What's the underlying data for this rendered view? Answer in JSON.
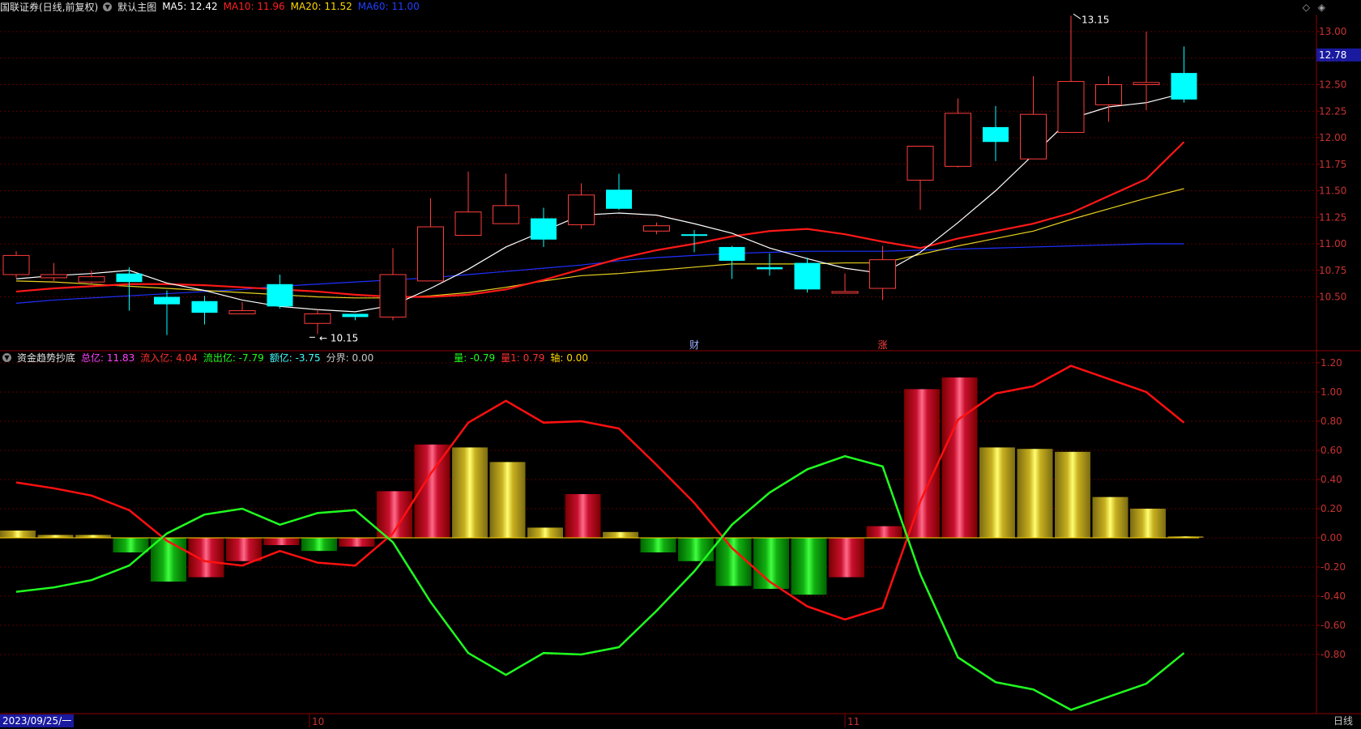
{
  "title": "国联证券(日线,前复权)",
  "main_indicator": "默认主图",
  "ma": [
    {
      "label": "MA5:",
      "value": "12.42",
      "color": "#ffffff"
    },
    {
      "label": "MA10:",
      "value": "11.96",
      "color": "#ff2020"
    },
    {
      "label": "MA20:",
      "value": "11.52",
      "color": "#ffd700"
    },
    {
      "label": "MA60:",
      "value": "11.00",
      "color": "#2040ff"
    }
  ],
  "sub_indicator": "资金趋势抄底",
  "sub_stats": [
    {
      "label": "总亿:",
      "value": "11.83",
      "color": "#ff40ff"
    },
    {
      "label": "流入亿:",
      "value": "4.04",
      "color": "#ff3030"
    },
    {
      "label": "流出亿:",
      "value": "-7.79",
      "color": "#20ff20"
    },
    {
      "label": "额亿:",
      "value": "-3.75",
      "color": "#40ffff"
    },
    {
      "label": "分界:",
      "value": "0.00",
      "color": "#c8c8c8"
    }
  ],
  "sub_stats2": [
    {
      "label": "量:",
      "value": "-0.79",
      "color": "#20ff20"
    },
    {
      "label": "量1:",
      "value": "0.79",
      "color": "#ff3030"
    },
    {
      "label": "轴:",
      "value": "0.00",
      "color": "#ffd700"
    }
  ],
  "price_axis": [
    "13.00",
    "12.75",
    "12.50",
    "12.25",
    "12.00",
    "11.75",
    "11.50",
    "11.25",
    "11.00",
    "10.75",
    "10.50"
  ],
  "current_price": "12.78",
  "high_label": "13.15",
  "low_label": "10.15",
  "event_markers": [
    "财",
    "涨"
  ],
  "osc_axis": [
    "1.20",
    "1.00",
    "0.80",
    "0.60",
    "0.40",
    "0.20",
    "0.00",
    "-0.20",
    "-0.40",
    "-0.60",
    "-0.80"
  ],
  "date_start": "2023/09/25/一",
  "month_labels": [
    "10",
    "11"
  ],
  "period_label": "日线",
  "chart_data": {
    "type": "candlestick",
    "candles": [
      {
        "o": 10.71,
        "c": 10.89,
        "h": 10.93,
        "l": 10.68
      },
      {
        "o": 10.68,
        "c": 10.71,
        "h": 10.82,
        "l": 10.65
      },
      {
        "o": 10.64,
        "c": 10.69,
        "h": 10.75,
        "l": 10.62
      },
      {
        "o": 10.72,
        "c": 10.64,
        "h": 10.78,
        "l": 10.37
      },
      {
        "o": 10.5,
        "c": 10.43,
        "h": 10.56,
        "l": 10.14
      },
      {
        "o": 10.46,
        "c": 10.35,
        "h": 10.51,
        "l": 10.24
      },
      {
        "o": 10.34,
        "c": 10.37,
        "h": 10.45,
        "l": 10.34
      },
      {
        "o": 10.62,
        "c": 10.41,
        "h": 10.71,
        "l": 10.39
      },
      {
        "o": 10.25,
        "c": 10.34,
        "h": 10.38,
        "l": 10.15
      },
      {
        "o": 10.34,
        "c": 10.31,
        "h": 10.34,
        "l": 10.28
      },
      {
        "o": 10.31,
        "c": 10.71,
        "h": 10.96,
        "l": 10.28
      },
      {
        "o": 10.65,
        "c": 11.16,
        "h": 11.43,
        "l": 10.65
      },
      {
        "o": 11.08,
        "c": 11.3,
        "h": 11.68,
        "l": 11.08
      },
      {
        "o": 11.19,
        "c": 11.36,
        "h": 11.66,
        "l": 11.19
      },
      {
        "o": 11.24,
        "c": 11.04,
        "h": 11.34,
        "l": 10.97
      },
      {
        "o": 11.18,
        "c": 11.46,
        "h": 11.57,
        "l": 11.14
      },
      {
        "o": 11.51,
        "c": 11.33,
        "h": 11.66,
        "l": 11.32
      },
      {
        "o": 11.12,
        "c": 11.17,
        "h": 11.2,
        "l": 11.09
      },
      {
        "o": 11.09,
        "c": 11.08,
        "h": 11.13,
        "l": 10.92
      },
      {
        "o": 10.97,
        "c": 10.84,
        "h": 10.98,
        "l": 10.67
      },
      {
        "o": 10.78,
        "c": 10.76,
        "h": 10.91,
        "l": 10.7
      },
      {
        "o": 10.82,
        "c": 10.57,
        "h": 10.87,
        "l": 10.54
      },
      {
        "o": 10.54,
        "c": 10.55,
        "h": 10.72,
        "l": 10.55
      },
      {
        "o": 10.58,
        "c": 10.85,
        "h": 10.98,
        "l": 10.47
      },
      {
        "o": 11.6,
        "c": 11.92,
        "h": 11.92,
        "l": 11.32
      },
      {
        "o": 11.73,
        "c": 12.23,
        "h": 12.37,
        "l": 11.72
      },
      {
        "o": 12.1,
        "c": 11.96,
        "h": 12.3,
        "l": 11.78
      },
      {
        "o": 11.8,
        "c": 12.22,
        "h": 12.58,
        "l": 11.8
      },
      {
        "o": 12.05,
        "c": 12.53,
        "h": 13.15,
        "l": 12.05
      },
      {
        "o": 12.31,
        "c": 12.5,
        "h": 12.58,
        "l": 12.15
      },
      {
        "o": 12.5,
        "c": 12.52,
        "h": 13.0,
        "l": 12.26
      },
      {
        "o": 12.61,
        "c": 12.36,
        "h": 12.86,
        "l": 12.33
      }
    ],
    "ma5": [
      10.67,
      10.7,
      10.72,
      10.75,
      10.63,
      10.56,
      10.47,
      10.41,
      10.38,
      10.36,
      10.42,
      10.58,
      10.76,
      10.97,
      11.12,
      11.27,
      11.29,
      11.27,
      11.19,
      11.1,
      10.96,
      10.86,
      10.77,
      10.72,
      10.92,
      11.2,
      11.5,
      11.84,
      12.18,
      12.29,
      12.33,
      12.42
    ],
    "ma10": [
      10.55,
      10.58,
      10.6,
      10.62,
      10.62,
      10.61,
      10.59,
      10.57,
      10.55,
      10.52,
      10.5,
      10.5,
      10.52,
      10.57,
      10.66,
      10.76,
      10.86,
      10.94,
      11.0,
      11.07,
      11.12,
      11.14,
      11.09,
      11.02,
      10.96,
      11.05,
      11.12,
      11.19,
      11.29,
      11.45,
      11.61,
      11.96
    ],
    "ma20": [
      10.65,
      10.64,
      10.62,
      10.6,
      10.58,
      10.56,
      10.54,
      10.52,
      10.5,
      10.49,
      10.49,
      10.51,
      10.54,
      10.59,
      10.65,
      10.7,
      10.72,
      10.75,
      10.78,
      10.81,
      10.81,
      10.81,
      10.82,
      10.82,
      10.9,
      10.98,
      11.05,
      11.12,
      11.23,
      11.33,
      11.43,
      11.52
    ],
    "ma60": [
      10.44,
      10.47,
      10.49,
      10.51,
      10.53,
      10.55,
      10.57,
      10.6,
      10.62,
      10.64,
      10.66,
      10.68,
      10.71,
      10.74,
      10.77,
      10.8,
      10.84,
      10.87,
      10.89,
      10.91,
      10.92,
      10.93,
      10.93,
      10.93,
      10.94,
      10.95,
      10.96,
      10.97,
      10.98,
      10.99,
      11.0,
      11.0
    ],
    "osc_bars": [
      0.05,
      0.02,
      0.02,
      -0.1,
      -0.3,
      -0.27,
      -0.16,
      -0.05,
      -0.09,
      -0.06,
      0.32,
      0.64,
      0.62,
      0.52,
      0.07,
      0.3,
      0.04,
      -0.1,
      -0.16,
      -0.33,
      -0.35,
      -0.39,
      -0.27,
      0.08,
      1.02,
      1.1,
      0.62,
      0.61,
      0.59,
      0.28,
      0.2,
      0.01
    ],
    "osc_bar_colors": [
      "yellow",
      "yellow",
      "yellow",
      "green",
      "green",
      "red",
      "red",
      "red",
      "green",
      "red",
      "red",
      "red",
      "yellow",
      "yellow",
      "yellow",
      "red",
      "yellow",
      "green",
      "green",
      "green",
      "green",
      "green",
      "red",
      "red",
      "red",
      "red",
      "yellow",
      "yellow",
      "yellow",
      "yellow",
      "yellow",
      "yellow"
    ],
    "red_line": [
      0.38,
      0.34,
      0.29,
      0.19,
      -0.02,
      -0.16,
      -0.19,
      -0.09,
      -0.17,
      -0.19,
      0.03,
      0.44,
      0.79,
      0.94,
      0.79,
      0.8,
      0.75,
      0.5,
      0.24,
      -0.07,
      -0.3,
      -0.47,
      -0.56,
      -0.48,
      0.25,
      0.81,
      0.99,
      1.04,
      1.18,
      1.09,
      1.0,
      0.79
    ],
    "green_line": [
      -0.37,
      -0.34,
      -0.29,
      -0.19,
      0.03,
      0.16,
      0.2,
      0.09,
      0.17,
      0.19,
      -0.03,
      -0.44,
      -0.79,
      -0.94,
      -0.79,
      -0.8,
      -0.75,
      -0.5,
      -0.23,
      0.09,
      0.31,
      0.47,
      0.56,
      0.49,
      -0.25,
      -0.82,
      -0.99,
      -1.04,
      -1.18,
      -1.09,
      -1.0,
      -0.79
    ]
  }
}
